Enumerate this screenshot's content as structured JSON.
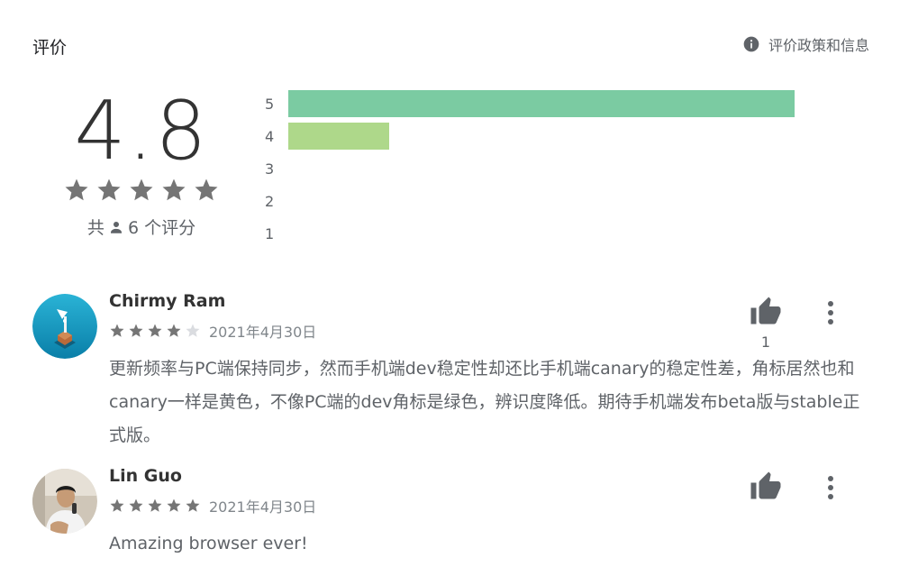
{
  "header": {
    "title": "评价",
    "policy_link": "评价政策和信息"
  },
  "summary": {
    "score": "4.8",
    "stars": 5,
    "count_prefix": "共",
    "count_value": "6 个评分"
  },
  "histogram": {
    "rows": [
      {
        "label": "5",
        "fraction": 1.0,
        "color": "#7bcba2"
      },
      {
        "label": "4",
        "fraction": 0.2,
        "color": "#aed88a"
      },
      {
        "label": "3",
        "fraction": 0,
        "color": "#f7d36b"
      },
      {
        "label": "2",
        "fraction": 0,
        "color": "#fbb26b"
      },
      {
        "label": "1",
        "fraction": 0,
        "color": "#f88a6b"
      }
    ]
  },
  "reviews": [
    {
      "author": "Chirmy Ram",
      "rating": 4,
      "date": "2021年4月30日",
      "text": "更新频率与PC端保持同步，然而手机端dev稳定性却还比手机端canary的稳定性差，角标居然也和canary一样是黄色，不像PC端的dev角标是绿色，辨识度降低。期待手机端发布beta版与stable正式版。",
      "helpful_count": "1"
    },
    {
      "author": "Lin Guo",
      "rating": 5,
      "date": "2021年4月30日",
      "text": "Amazing browser ever!",
      "helpful_count": ""
    }
  ],
  "colors": {
    "star": "#757575",
    "star_empty": "#dadce0",
    "icon": "#5f6368"
  }
}
